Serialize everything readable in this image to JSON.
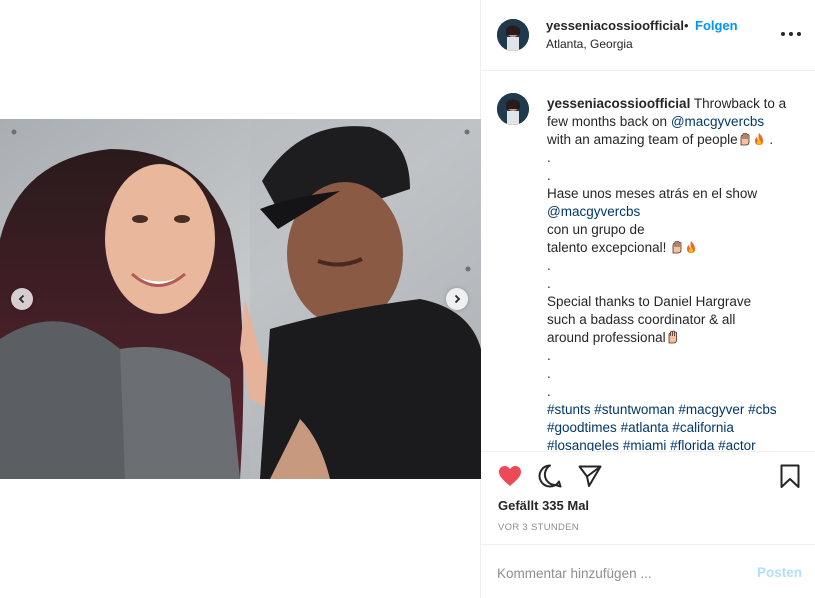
{
  "post": {
    "username": "yesseniacossioofficial",
    "separator": "•",
    "follow_label": "Folgen",
    "location": "Atlanta, Georgia"
  },
  "caption": {
    "username": "yesseniacossioofficial",
    "lines": [
      "Throwback to a",
      "few months back on",
      "@macgyvercbs",
      "with an amazing team of people",
      ".",
      ".",
      ".",
      "Hase unos meses atrás en el show",
      "@macgyvercbs",
      "con un grupo de",
      "talento excepcional!",
      ".",
      ".",
      "Special thanks to Daniel Hargrave",
      "such a badass coordinator & all",
      "around professional",
      ".",
      ".",
      ".",
      "#stunts",
      "#stuntwoman",
      "#macgyver",
      "#cbs",
      "#goodtimes",
      "#atlanta",
      "#california",
      "#losangeles",
      "#miami",
      "#florida",
      "#actor"
    ]
  },
  "engagement": {
    "likes_text": "Gefällt 335 Mal",
    "timestamp": "VOR 3 STUNDEN"
  },
  "comment_box": {
    "placeholder": "Kommentar hinzufügen ...",
    "post_label": "Posten"
  },
  "colors": {
    "accent_blue": "#0095f6",
    "like_red": "#ed4956",
    "tag_blue": "#00376b",
    "post_disabled": "#b2dffc"
  },
  "icons": {
    "like": "heart-filled-icon",
    "comment": "comment-bubble-icon",
    "share": "paper-plane-icon",
    "save": "bookmark-icon",
    "more": "more-dots-icon",
    "prev": "chevron-left-icon",
    "next": "chevron-right-icon"
  }
}
